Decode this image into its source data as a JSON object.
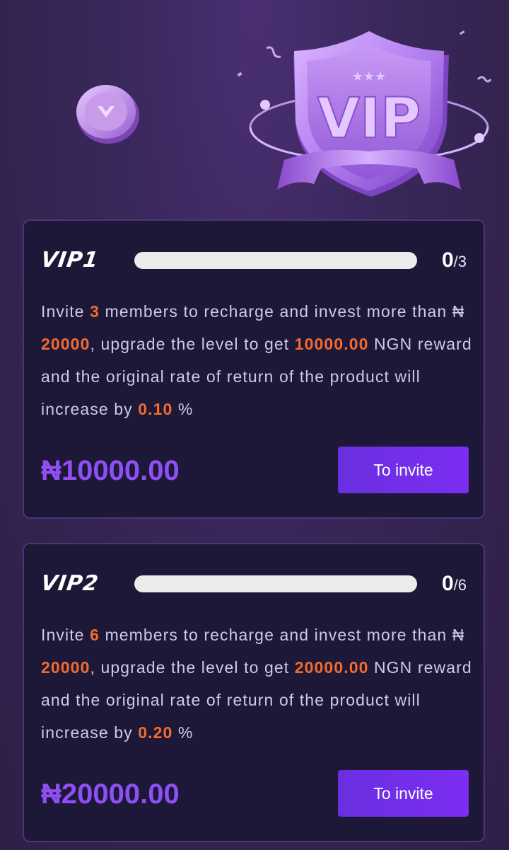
{
  "hero": {
    "badge_text": "VIP"
  },
  "vip_levels": [
    {
      "label": "VIP1",
      "progress_current": "0",
      "progress_separator": "/",
      "progress_total": "3",
      "progress_fraction": 0,
      "desc_1": "Invite ",
      "members": "3",
      "desc_2": " members to recharge and invest more than ",
      "currency": "₦",
      "space": " ",
      "threshold": "20000",
      "desc_3": ", upgrade the level to get ",
      "reward_amount": "10000.00",
      "desc_4": " NGN reward and the original rate of return of the product will increase by ",
      "rate": "0.10",
      "desc_5": " %",
      "reward_display": "₦10000.00",
      "button_label": "To invite"
    },
    {
      "label": "VIP2",
      "progress_current": "0",
      "progress_separator": "/",
      "progress_total": "6",
      "progress_fraction": 0,
      "desc_1": "Invite ",
      "members": "6",
      "desc_2": " members to recharge and invest more than ",
      "currency": "₦",
      "space": " ",
      "threshold": "20000",
      "desc_3": ", upgrade the level to get ",
      "reward_amount": "20000.00",
      "desc_4": " NGN reward and the original rate of return of the product will increase by ",
      "rate": "0.20",
      "desc_5": " %",
      "reward_display": "₦20000.00",
      "button_label": "To invite"
    }
  ],
  "colors": {
    "accent_purple": "#8e4ff5",
    "highlight_orange": "#f26b2e",
    "card_bg": "#1e1838",
    "button_bg": "#7c2ef2"
  }
}
